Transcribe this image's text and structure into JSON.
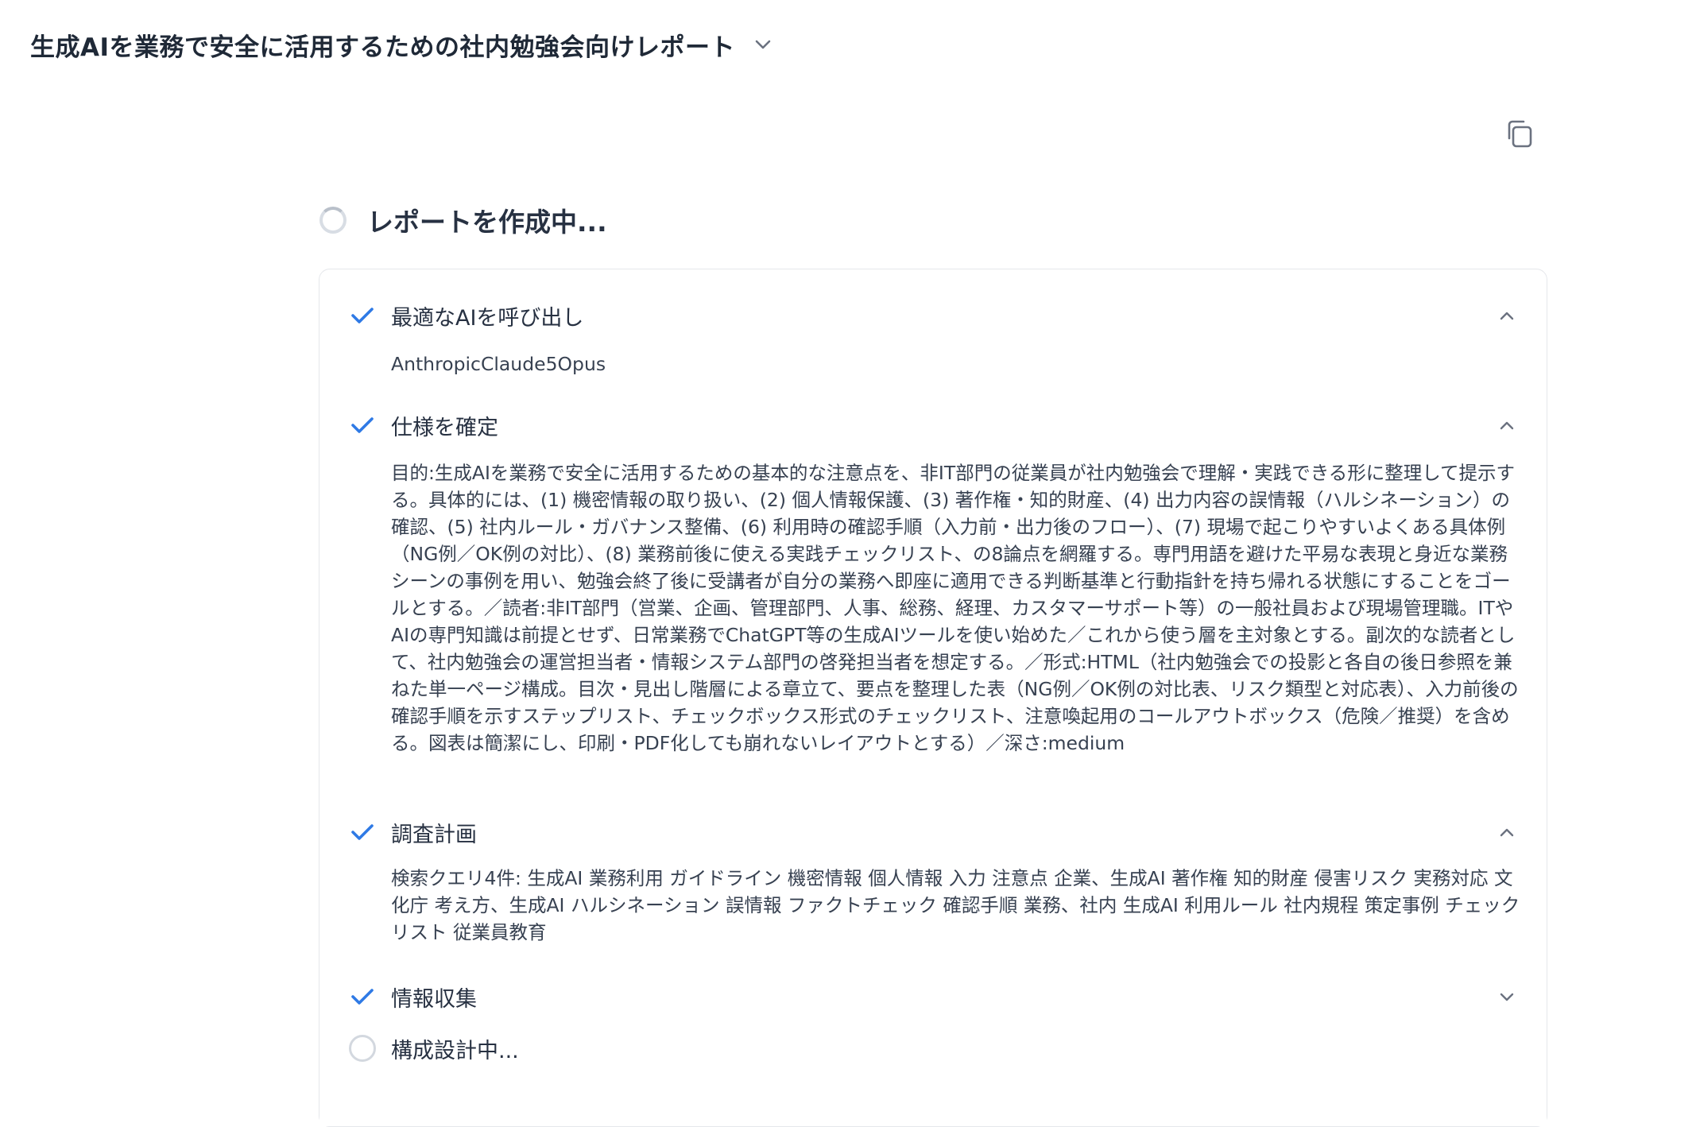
{
  "header": {
    "title": "生成AIを業務で安全に活用するための社内勉強会向けレポート",
    "chevron_icon": "chevron-down-icon",
    "copy_icon": "copy-icon"
  },
  "status": {
    "text": "レポートを作成中...",
    "icon": "spinner-icon"
  },
  "colors": {
    "accent_check": "#2f7ae5",
    "text_primary": "#1f2937",
    "border": "#e5e7eb",
    "pending_ring": "#d3d8df"
  },
  "steps": [
    {
      "title": "最適なAIを呼び出し",
      "state": "done",
      "expanded": true,
      "body": "AnthropicClaude5Opus"
    },
    {
      "title": "仕様を確定",
      "state": "done",
      "expanded": true,
      "body": "目的:生成AIを業務で安全に活用するための基本的な注意点を、非IT部門の従業員が社内勉強会で理解・実践できる形に整理して提示する。具体的には、(1) 機密情報の取り扱い、(2) 個人情報保護、(3) 著作権・知的財産、(4) 出力内容の誤情報（ハルシネーション）の確認、(5) 社内ルール・ガバナンス整備、(6) 利用時の確認手順（入力前・出力後のフロー）、(7) 現場で起こりやすいよくある具体例（NG例／OK例の対比）、(8) 業務前後に使える実践チェックリスト、の8論点を網羅する。専門用語を避けた平易な表現と身近な業務シーンの事例を用い、勉強会終了後に受講者が自分の業務へ即座に適用できる判断基準と行動指針を持ち帰れる状態にすることをゴールとする。／読者:非IT部門（営業、企画、管理部門、人事、総務、経理、カスタマーサポート等）の一般社員および現場管理職。ITやAIの専門知識は前提とせず、日常業務でChatGPT等の生成AIツールを使い始めた／これから使う層を主対象とする。副次的な読者として、社内勉強会の運営担当者・情報システム部門の啓発担当者を想定する。／形式:HTML（社内勉強会での投影と各自の後日参照を兼ねた単一ページ構成。目次・見出し階層による章立て、要点を整理した表（NG例／OK例の対比表、リスク類型と対応表）、入力前後の確認手順を示すステップリスト、チェックボックス形式のチェックリスト、注意喚起用のコールアウトボックス（危険／推奨）を含める。図表は簡潔にし、印刷・PDF化しても崩れないレイアウトとする）／深さ:medium"
    },
    {
      "title": "調査計画",
      "state": "done",
      "expanded": true,
      "body": "検索クエリ4件: 生成AI 業務利用 ガイドライン 機密情報 個人情報 入力 注意点 企業、生成AI 著作権 知的財産 侵害リスク 実務対応 文化庁 考え方、生成AI ハルシネーション 誤情報 ファクトチェック 確認手順 業務、社内 生成AI 利用ルール 社内規程 策定事例 チェックリスト 従業員教育"
    },
    {
      "title": "情報収集",
      "state": "done",
      "expanded": false,
      "body": ""
    },
    {
      "title": "構成設計中...",
      "state": "pending",
      "expanded": false,
      "body": ""
    }
  ]
}
